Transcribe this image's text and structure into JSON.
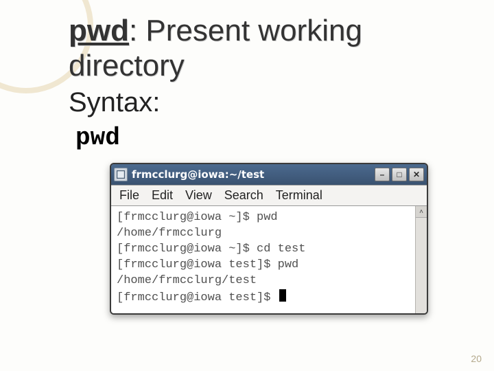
{
  "title": {
    "cmd": "pwd",
    "desc": ": Present working directory"
  },
  "syntax_label": "Syntax:",
  "syntax_cmd": "pwd",
  "terminal": {
    "window_title": "frmcclurg@iowa:~/test",
    "menubar": [
      "File",
      "Edit",
      "View",
      "Search",
      "Terminal"
    ],
    "lines": [
      "[frmcclurg@iowa ~]$ pwd",
      "/home/frmcclurg",
      "[frmcclurg@iowa ~]$ cd test",
      "[frmcclurg@iowa test]$ pwd",
      "/home/frmcclurg/test",
      "[frmcclurg@iowa test]$ "
    ],
    "win_buttons": {
      "minimize": "–",
      "maximize": "□",
      "close": "✕"
    },
    "scroll_up_glyph": "˄"
  },
  "page_number": "20"
}
